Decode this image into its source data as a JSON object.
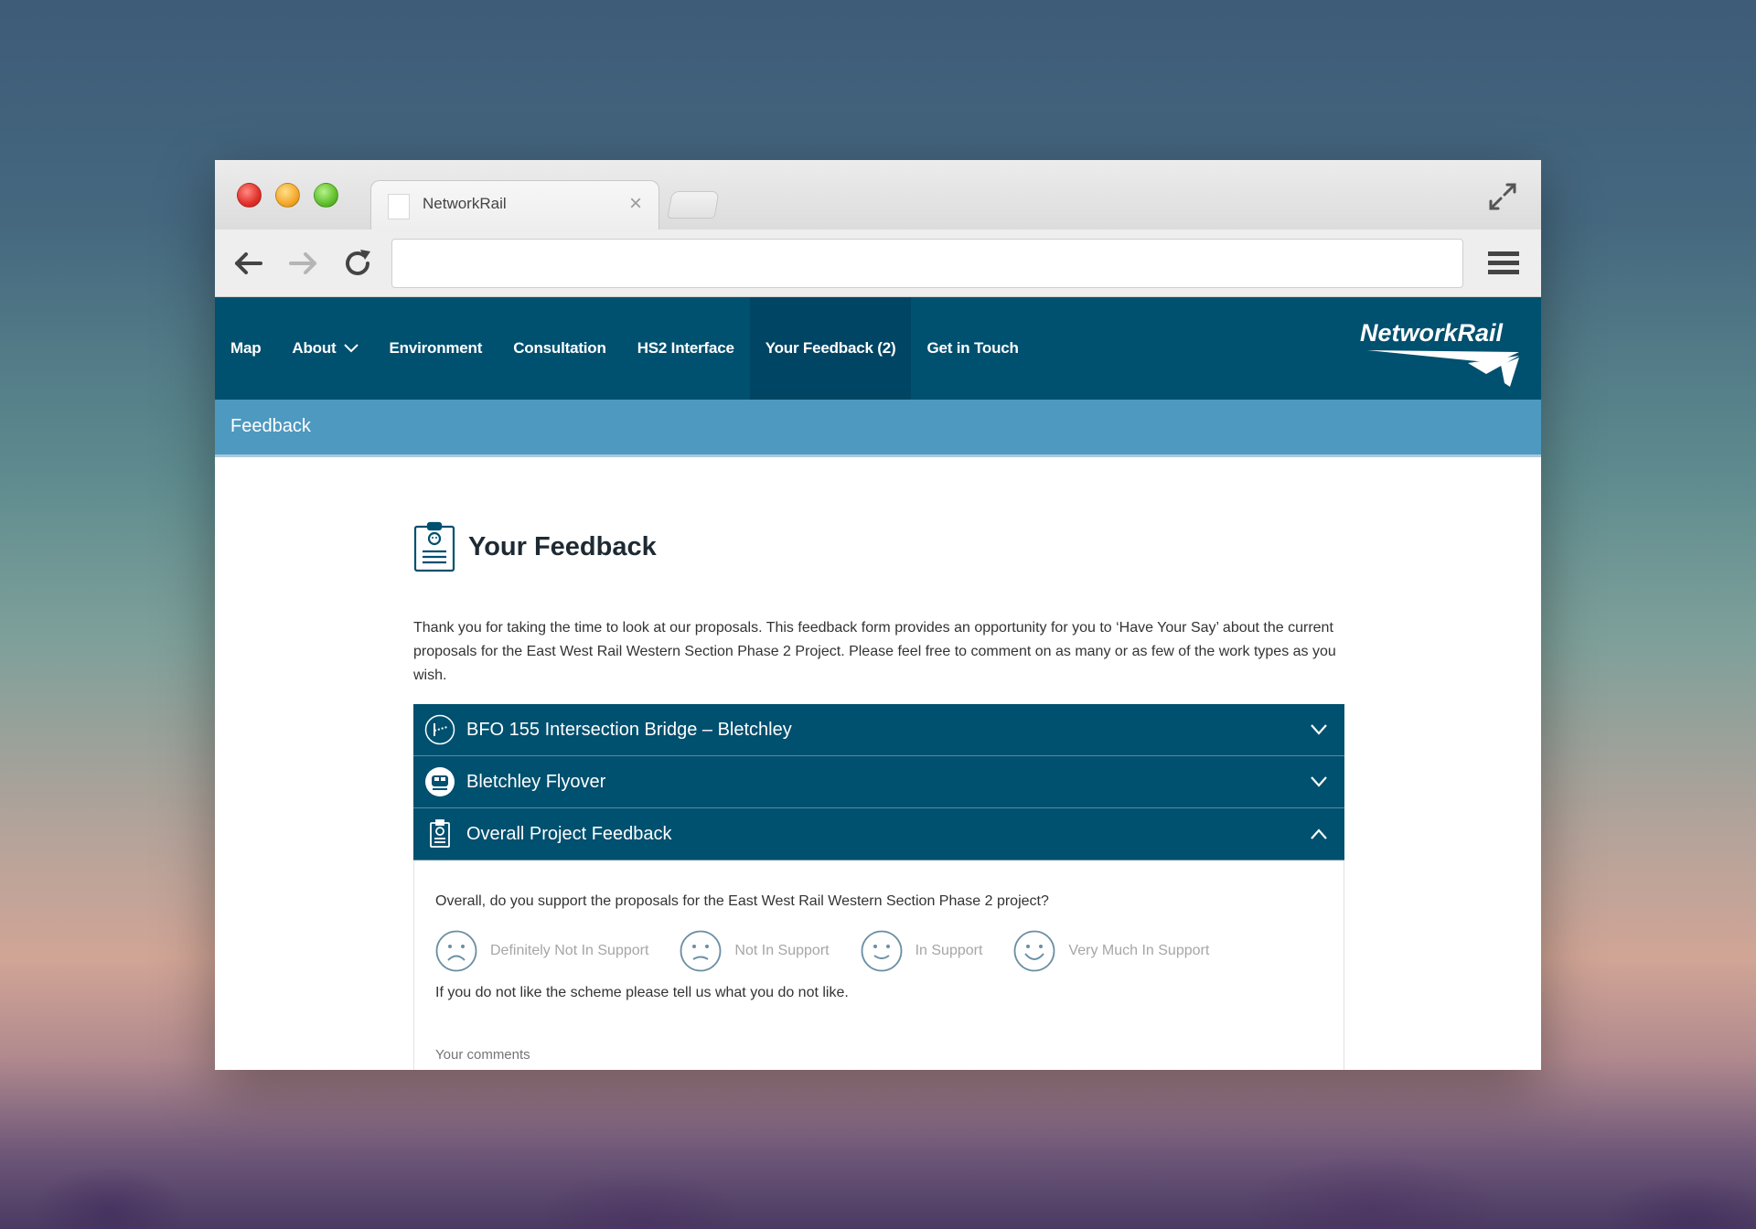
{
  "browser": {
    "tab_title": "NetworkRail",
    "address_value": ""
  },
  "site": {
    "nav_items": [
      "Map",
      "About",
      "Environment",
      "Consultation",
      "HS2 Interface",
      "Your Feedback (2)",
      "Get in Touch"
    ],
    "active_nav": "Your Feedback (2)",
    "logo_text": "NetworkRail",
    "subbar_title": "Feedback",
    "colors": {
      "nav_bg": "#00506f",
      "subbar_bg": "#4e99c0"
    }
  },
  "page": {
    "title": "Your Feedback",
    "intro": "Thank you for taking the time to look at our proposals. This feedback form provides an opportunity for you to ‘Have Your Say’ about the current proposals for the East West Rail Western Section Phase 2 Project. Please feel free to comment on as many or as few of the work types as you wish."
  },
  "accordion": [
    {
      "title": "BFO 155 Intersection Bridge – Bletchley",
      "expanded": false,
      "icon": "bridge-icon"
    },
    {
      "title": "Bletchley Flyover",
      "expanded": false,
      "icon": "train-icon"
    },
    {
      "title": "Overall Project Feedback",
      "expanded": true,
      "icon": "clipboard-icon"
    }
  ],
  "feedback": {
    "question": "Overall, do you support the proposals for the East West Rail Western Section Phase 2 project?",
    "ratings": [
      "Definitely Not In Support",
      "Not In Support",
      "In Support",
      "Very Much In Support"
    ],
    "dislike_prompt": "If you do not like the scheme please tell us what you do not like.",
    "comments_placeholder": "Your comments"
  }
}
